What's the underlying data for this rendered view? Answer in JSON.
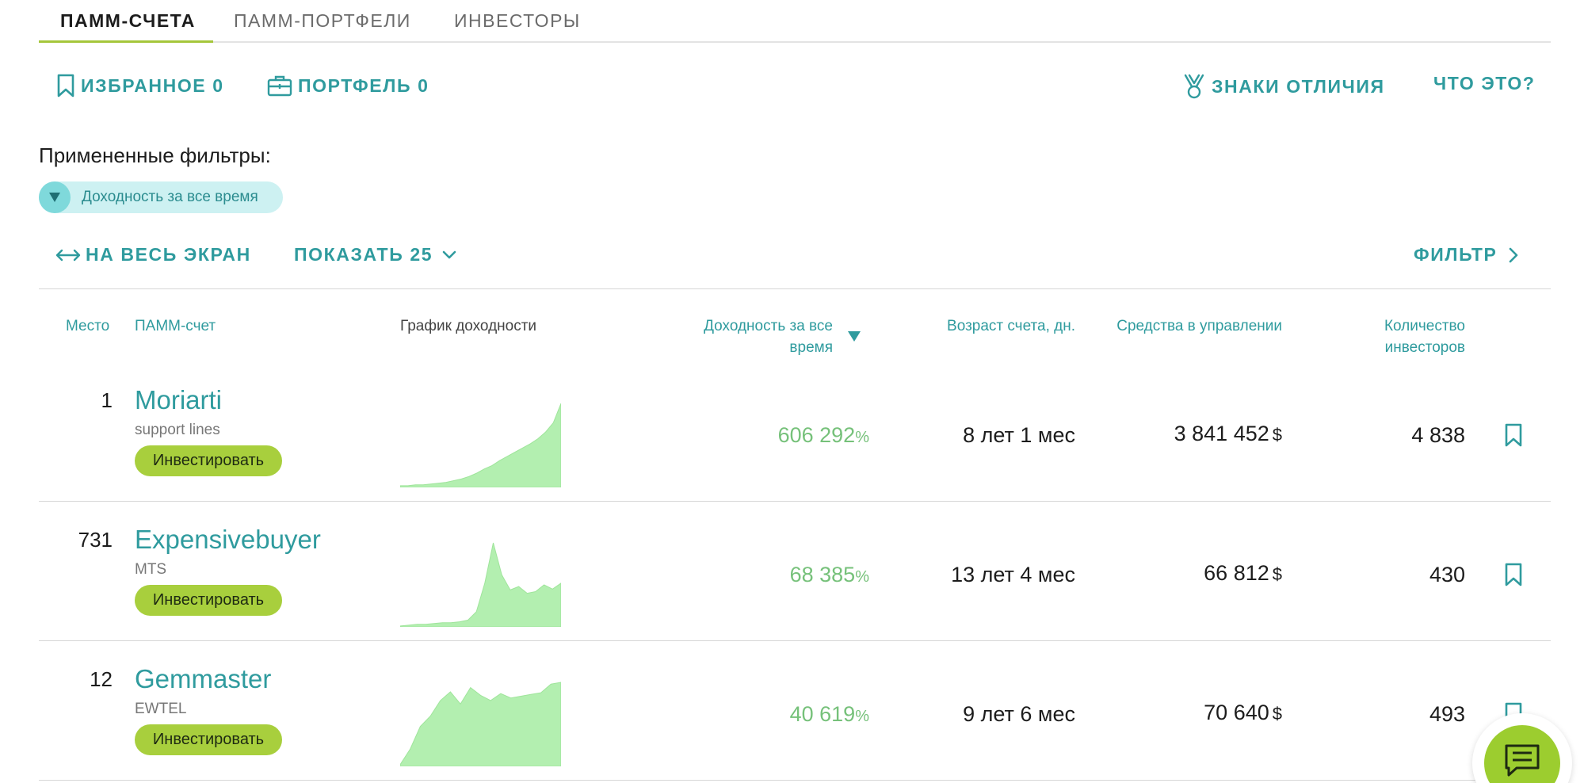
{
  "tabs": [
    {
      "label": "ПАММ-СЧЕТА",
      "active": true
    },
    {
      "label": "ПАММ-ПОРТФЕЛИ",
      "active": false
    },
    {
      "label": "ИНВЕСТОРЫ",
      "active": false
    }
  ],
  "toolbar": {
    "favorites_label": "ИЗБРАННОЕ 0",
    "portfolio_label": "ПОРТФЕЛЬ 0",
    "badges_label": "ЗНАКИ ОТЛИЧИЯ",
    "what_is_label": "ЧТО ЭТО?"
  },
  "filters": {
    "title": "Примененные фильтры:",
    "chips": [
      {
        "label": "Доходность за все время",
        "icon": "triangle-down-icon"
      }
    ]
  },
  "controls": {
    "fullscreen_label": "НА ВЕСЬ ЭКРАН",
    "show_label": "ПОКАЗАТЬ 25",
    "filter_label": "ФИЛЬТР"
  },
  "table": {
    "headers": {
      "place": "Место",
      "account": "ПАММ-счет",
      "chart": "График доходности",
      "yield_line1": "Доходность за все",
      "yield_line2": "время",
      "age": "Возраст счета, дн.",
      "funds": "Средства в управлении",
      "investors_line1": "Количество",
      "investors_line2": "инвесторов"
    },
    "sort_indicator": "sort-desc-icon",
    "invest_label": "Инвестировать",
    "rows": [
      {
        "rank": "1",
        "name": "Moriarti",
        "subtitle": "support lines",
        "yield": "606 292",
        "yield_unit": "%",
        "age": "8 лет 1 мес",
        "funds": "3 841 452",
        "currency": "$",
        "investors": "4 838"
      },
      {
        "rank": "731",
        "name": "Expensivebuyer",
        "subtitle": "MTS",
        "yield": "68 385",
        "yield_unit": "%",
        "age": "13 лет 4 мес",
        "funds": "66 812",
        "currency": "$",
        "investors": "430"
      },
      {
        "rank": "12",
        "name": "Gemmaster",
        "subtitle": "EWTEL",
        "yield": "40 619",
        "yield_unit": "%",
        "age": "9 лет 6 мес",
        "funds": "70 640",
        "currency": "$",
        "investors": "493"
      }
    ]
  },
  "colors": {
    "accent_teal": "#2f9b9e",
    "invest_green": "#a8cf3d",
    "yield_green": "#76c17a",
    "sparkline_fill": "#b3efb0",
    "chip_bg": "#cdf1f2"
  },
  "sparklines": [
    [
      2,
      2,
      3,
      3,
      4,
      5,
      6,
      8,
      10,
      13,
      17,
      22,
      26,
      32,
      37,
      42,
      47,
      52,
      58,
      66,
      77,
      100
    ],
    [
      1,
      2,
      3,
      3,
      4,
      5,
      5,
      6,
      8,
      18,
      52,
      100,
      62,
      44,
      48,
      40,
      42,
      50,
      45,
      52
    ],
    [
      2,
      20,
      46,
      58,
      76,
      86,
      72,
      91,
      82,
      76,
      84,
      79,
      81,
      83,
      85,
      95,
      97
    ]
  ],
  "chat_icon": "chat-icon"
}
